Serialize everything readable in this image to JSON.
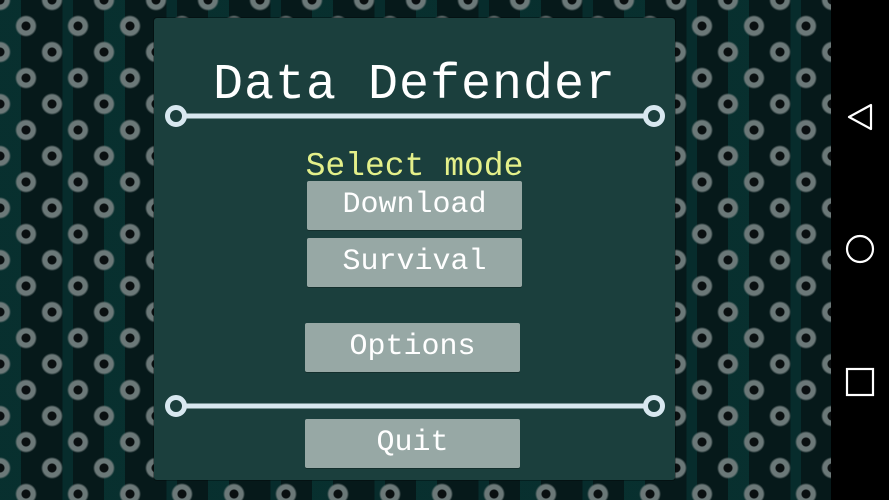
{
  "game": {
    "title": "Data Defender",
    "subtitle": "Select mode",
    "buttons": {
      "download": "Download",
      "survival": "Survival",
      "options": "Options",
      "quit": "Quit"
    }
  },
  "colors": {
    "panel": "#1b3f3d",
    "button": "#97a8a5",
    "subtitle": "#e4f08a",
    "divider": "#d8e8f0"
  },
  "navigation_bar": {
    "back_icon": "back-triangle-icon",
    "home_icon": "home-circle-icon",
    "recents_icon": "recents-square-icon"
  }
}
